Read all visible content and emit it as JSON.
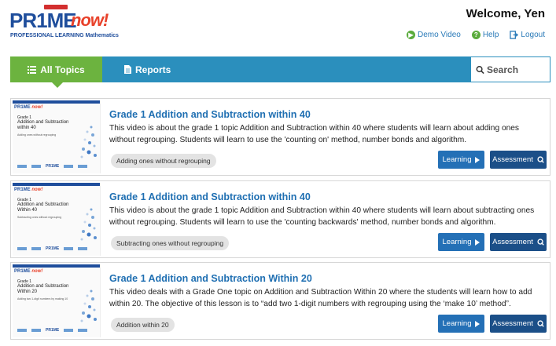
{
  "header": {
    "logo_prime": "PR1ME",
    "logo_now": "now!",
    "logo_sub": "PROFESSIONAL LEARNING Mathematics",
    "welcome": "Welcome, Yen",
    "links": {
      "demo_video": "Demo Video",
      "help": "Help",
      "logout": "Logout"
    }
  },
  "nav": {
    "all_topics": "All Topics",
    "reports": "Reports",
    "search_placeholder": "Search"
  },
  "colors": {
    "nav_blue": "#2b8fbd",
    "tab_green": "#6cb33f",
    "title_blue": "#1f6fb2",
    "learning_button": "#2470b6",
    "assessment_button": "#1b4f88"
  },
  "cards": [
    {
      "thumb_grade": "Grade 1",
      "thumb_title": "Addition and Subtraction within 40",
      "thumb_sub": "Adding ones without regrouping",
      "title": "Grade 1 Addition and Subtraction within 40",
      "description": "This video is about the grade 1 topic Addition and Subtraction within 40 where students will learn about adding ones without regrouping. Students will learn to use the 'counting on' method, number bonds and algorithm.",
      "tag": "Adding ones without regrouping",
      "learning": "Learning",
      "assessment": "Assessment"
    },
    {
      "thumb_grade": "Grade 1",
      "thumb_title": "Addition and Subtraction Within 40",
      "thumb_sub": "Subtracting ones without regrouping",
      "title": "Grade 1 Addition and Subtraction within 40",
      "description": "This video is about the grade 1 topic Addition and Subtraction within 40 where students will learn about subtracting ones without regrouping. Students will learn to use the 'counting backwards' method, number bonds and algorithm.",
      "tag": "Subtracting ones without regrouping",
      "learning": "Learning",
      "assessment": "Assessment"
    },
    {
      "thumb_grade": "Grade 1",
      "thumb_title": "Addition and Subtraction Within 20",
      "thumb_sub": "Adding two 1-digit numbers by making 10",
      "title": "Grade 1 Addition and Subtraction Within 20",
      "description": "This video deals with a Grade One topic on Addition and Subtraction Within 20 where the students will learn how to add within 20. The objective of this lesson is to “add two 1-digit numbers with regrouping using the ‘make 10’ method”.",
      "tag": "Addition within 20",
      "learning": "Learning",
      "assessment": "Assessment"
    }
  ]
}
